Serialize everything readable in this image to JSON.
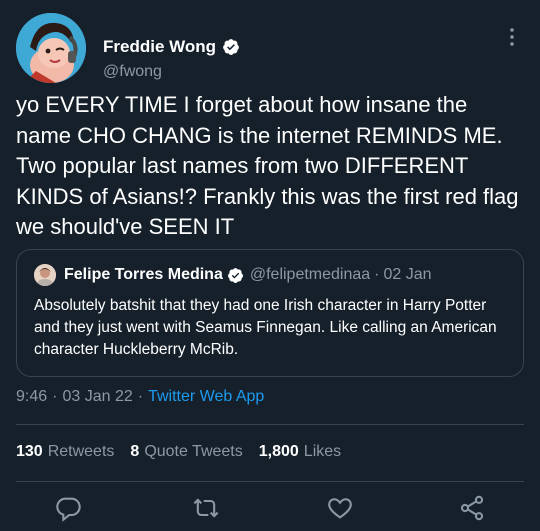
{
  "author": {
    "name": "Freddie Wong",
    "handle": "@fwong"
  },
  "tweet": {
    "text": "yo EVERY TIME I forget about how insane the name CHO CHANG is the internet REMINDS ME. Two popular last names from two DIFFERENT KINDS of Asians!? Frankly this was the first red flag we should've SEEN IT"
  },
  "quote": {
    "name": "Felipe Torres Medina",
    "handle": "@felipetmedinaa",
    "separator": "·",
    "date": "02 Jan",
    "text": "Absolutely batshit that they had one Irish character in Harry Potter and they just went with Seamus Finnegan. Like calling an American character Huckleberry McRib."
  },
  "meta": {
    "time": "9:46",
    "dot1": "·",
    "date": "03 Jan 22",
    "dot2": "·",
    "app": "Twitter Web App"
  },
  "stats": {
    "retweets_count": "130",
    "retweets_label": "Retweets",
    "quotes_count": "8",
    "quotes_label": "Quote Tweets",
    "likes_count": "1,800",
    "likes_label": "Likes"
  },
  "icons": {
    "reply": "reply-icon",
    "retweet": "retweet-icon",
    "like": "like-icon",
    "share": "share-icon",
    "verified": "verified-icon",
    "more": "more-icon"
  },
  "colors": {
    "background": "#15202b",
    "secondary_text": "#8b98a5",
    "link": "#1d9bf0",
    "border": "#38444d"
  }
}
